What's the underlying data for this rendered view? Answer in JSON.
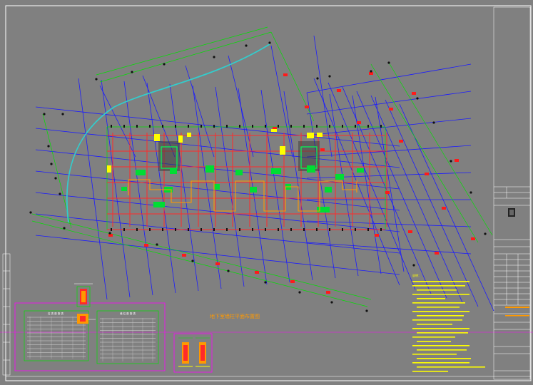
{
  "drawing": {
    "plan_title": "地下室墙柱平面布置图",
    "notes_heading": "说明："
  },
  "tables": {
    "table_a_title": "柱 表 配 筋 表",
    "table_b_title": "墙 柱 配 筋 表"
  },
  "colors": {
    "background": "#808080",
    "frame": "#ffffff",
    "grid": "#1a1aff",
    "wall": "#ff2a2a",
    "green": "#00e000",
    "yellow": "#ffff00",
    "cyan": "#33cccc",
    "magenta": "#ff00ff",
    "orange": "#ff9900"
  }
}
